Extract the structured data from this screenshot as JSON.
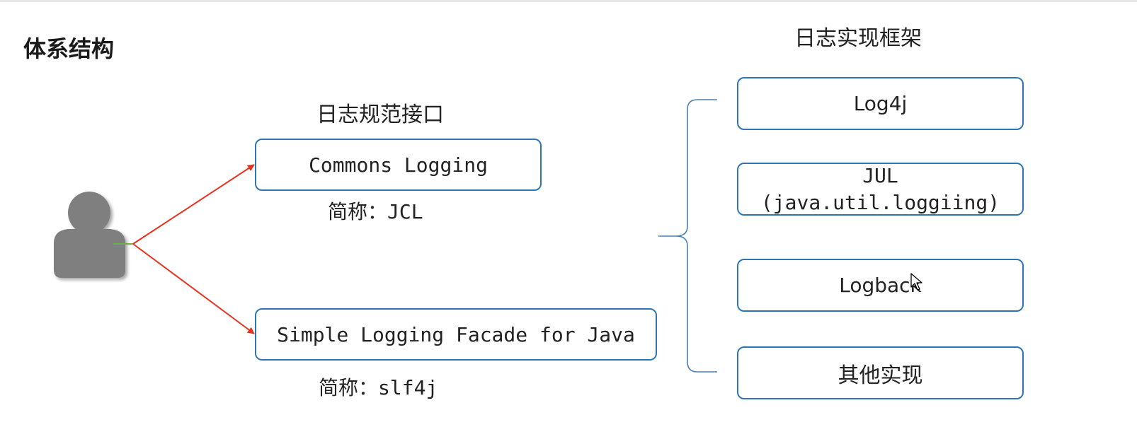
{
  "title": "体系结构",
  "interfaces": {
    "heading": "日志规范接口",
    "items": [
      {
        "label": "Commons Logging",
        "abbr_label": "简称：",
        "abbr_value": "JCL"
      },
      {
        "label": "Simple Logging Facade for Java",
        "abbr_label": "简称：",
        "abbr_value": "slf4j"
      }
    ]
  },
  "implementations": {
    "heading": "日志实现框架",
    "items": [
      {
        "label": "Log4j"
      },
      {
        "label_line1": "JUL",
        "label_line2": "(java.util.loggiing)"
      },
      {
        "label": "Logback"
      },
      {
        "label": "其他实现"
      }
    ]
  },
  "colors": {
    "box_border": "#2e75b6",
    "arrow": "#e8321e",
    "brace": "#4a7fb5",
    "user_icon": "#7f7f7f",
    "connector_stub": "#70ad47"
  }
}
